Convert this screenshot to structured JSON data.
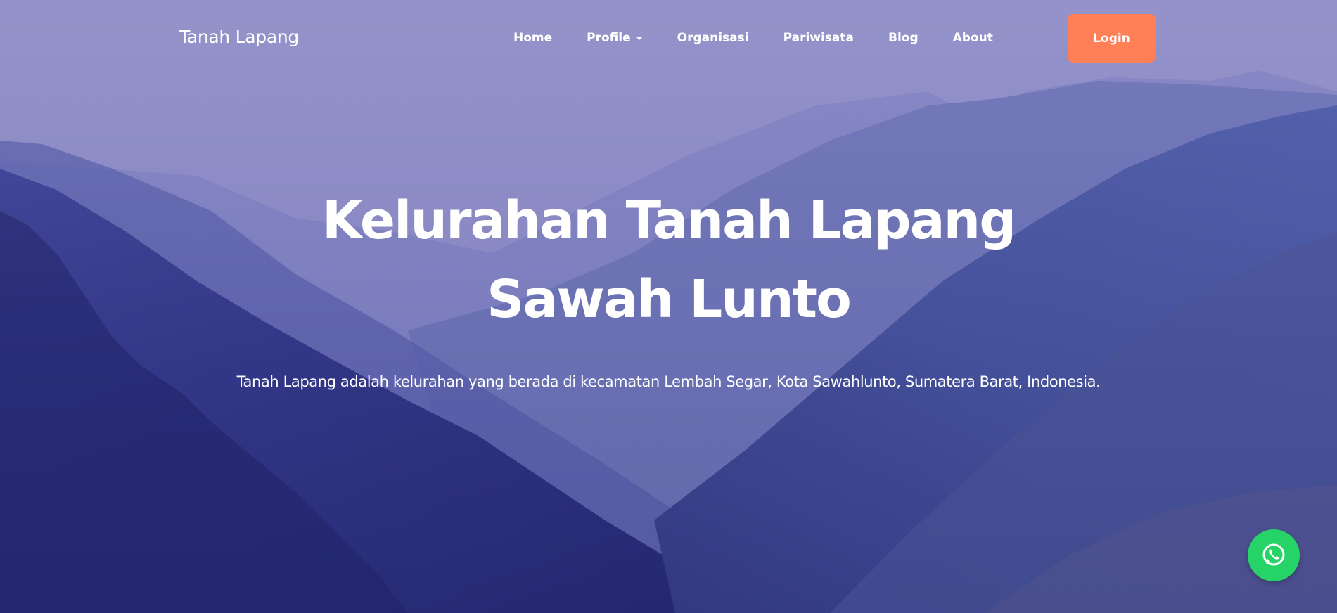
{
  "navbar": {
    "brand": "Tanah Lapang",
    "items": [
      {
        "label": "Home"
      },
      {
        "label": "Profile",
        "dropdown": true
      },
      {
        "label": "Organisasi"
      },
      {
        "label": "Pariwisata"
      },
      {
        "label": "Blog"
      },
      {
        "label": "About"
      }
    ],
    "login_label": "Login"
  },
  "hero": {
    "title_line1": "Kelurahan Tanah Lapang",
    "title_line2": "Sawah Lunto",
    "subtitle": "Tanah Lapang adalah kelurahan yang berada di kecamatan Lembah Segar, Kota Sawahlunto, Sumatera Barat, Indonesia."
  },
  "floating": {
    "whatsapp_icon": "whatsapp-icon"
  },
  "colors": {
    "login_button": "#ff7f57",
    "whatsapp": "#25d366",
    "overlay": "#6f72c0"
  }
}
